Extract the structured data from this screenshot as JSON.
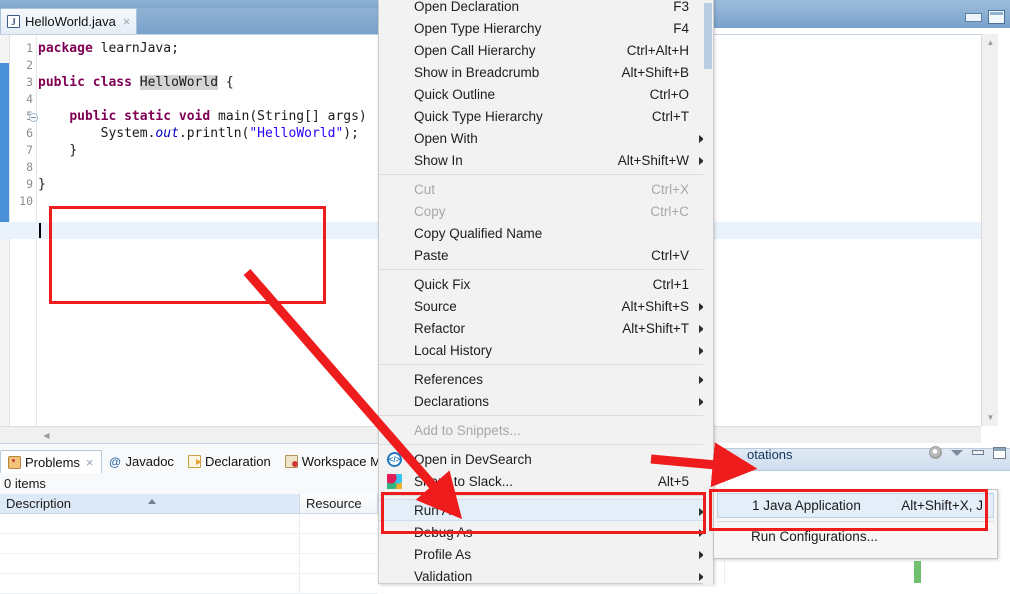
{
  "window": {
    "minimize_label": "minimize",
    "maximize_label": "maximize"
  },
  "editor": {
    "tab": {
      "label": "HelloWorld.java",
      "icon": "java-file-icon",
      "close": "×"
    },
    "line_numbers": [
      "1",
      "2",
      "3",
      "4",
      "5",
      "6",
      "7",
      "8",
      "9",
      "10"
    ],
    "code_lines": [
      {
        "n": 1,
        "text": "package learnJava;"
      },
      {
        "n": 2,
        "text": ""
      },
      {
        "n": 3,
        "text": "public class HelloWorld {"
      },
      {
        "n": 4,
        "text": ""
      },
      {
        "n": 5,
        "text": "    public static void main(String[] args)"
      },
      {
        "n": 6,
        "text": "        System.out.println(\"HelloWorld\");"
      },
      {
        "n": 7,
        "text": "    }"
      },
      {
        "n": 8,
        "text": ""
      },
      {
        "n": 9,
        "text": "}"
      },
      {
        "n": 10,
        "text": ""
      }
    ],
    "tokens": {
      "package": "package",
      "ns_learnjava": " learnJava;",
      "public": "public",
      "class": "class",
      "helloworld_type": "HelloWorld",
      "brace_open": " {",
      "static": "static",
      "void": "void",
      "main_sig": " main(String[] args)",
      "system": "System.",
      "out": "out",
      "println_open": ".println(",
      "hello_string": "\"HelloWorld\"",
      "println_close": ");",
      "brace_close_inner": "}",
      "brace_close_outer": "}"
    }
  },
  "context_menu": {
    "items": [
      {
        "label": "Open Declaration",
        "accel": "F3",
        "state": "normal",
        "submenu": false,
        "clipped": true
      },
      {
        "label": "Open Type Hierarchy",
        "accel": "F4",
        "state": "normal",
        "submenu": false
      },
      {
        "label": "Open Call Hierarchy",
        "accel": "Ctrl+Alt+H",
        "state": "normal",
        "submenu": false
      },
      {
        "label": "Show in Breadcrumb",
        "accel": "Alt+Shift+B",
        "state": "normal",
        "submenu": false
      },
      {
        "label": "Quick Outline",
        "accel": "Ctrl+O",
        "state": "normal",
        "submenu": false
      },
      {
        "label": "Quick Type Hierarchy",
        "accel": "Ctrl+T",
        "state": "normal",
        "submenu": false
      },
      {
        "label": "Open With",
        "accel": "",
        "state": "normal",
        "submenu": true
      },
      {
        "label": "Show In",
        "accel": "Alt+Shift+W",
        "state": "normal",
        "submenu": true
      },
      {
        "separator": true
      },
      {
        "label": "Cut",
        "accel": "Ctrl+X",
        "state": "disabled",
        "submenu": false
      },
      {
        "label": "Copy",
        "accel": "Ctrl+C",
        "state": "disabled",
        "submenu": false
      },
      {
        "label": "Copy Qualified Name",
        "accel": "",
        "state": "normal",
        "submenu": false
      },
      {
        "label": "Paste",
        "accel": "Ctrl+V",
        "state": "normal",
        "submenu": false
      },
      {
        "separator": true
      },
      {
        "label": "Quick Fix",
        "accel": "Ctrl+1",
        "state": "normal",
        "submenu": false
      },
      {
        "label": "Source",
        "accel": "Alt+Shift+S",
        "state": "normal",
        "submenu": true
      },
      {
        "label": "Refactor",
        "accel": "Alt+Shift+T",
        "state": "normal",
        "submenu": true
      },
      {
        "label": "Local History",
        "accel": "",
        "state": "normal",
        "submenu": true
      },
      {
        "separator": true
      },
      {
        "label": "References",
        "accel": "",
        "state": "normal",
        "submenu": true
      },
      {
        "label": "Declarations",
        "accel": "",
        "state": "normal",
        "submenu": true
      },
      {
        "separator": true
      },
      {
        "label": "Add to Snippets...",
        "accel": "",
        "state": "disabled",
        "submenu": false
      },
      {
        "separator": true
      },
      {
        "label": "Open in DevSearch",
        "accel": "",
        "state": "normal",
        "submenu": false,
        "icon": "devsearch-icon"
      },
      {
        "label": "Share to Slack...",
        "accel": "Alt+5",
        "state": "normal",
        "submenu": false,
        "icon": "slack-icon"
      },
      {
        "separator": true
      },
      {
        "label": "Run As",
        "accel": "",
        "state": "hover",
        "submenu": true
      },
      {
        "label": "Debug As",
        "accel": "",
        "state": "normal",
        "submenu": true
      },
      {
        "label": "Profile As",
        "accel": "",
        "state": "normal",
        "submenu": true
      },
      {
        "label": "Validation",
        "accel": "",
        "state": "normal",
        "submenu": true
      }
    ]
  },
  "run_as_submenu": {
    "items": [
      {
        "label": "1 Java Application",
        "accel": "Alt+Shift+X, J",
        "selected": true,
        "icon": "java-app-icon"
      },
      {
        "label": "Run Configurations...",
        "accel": "",
        "selected": false
      }
    ]
  },
  "bottom_panel": {
    "tabs": [
      {
        "label": "Problems",
        "icon": "problems-icon",
        "active": true,
        "closable": true
      },
      {
        "label": "Javadoc",
        "icon": "javadoc-icon",
        "active": false
      },
      {
        "label": "Declaration",
        "icon": "declaration-icon",
        "active": false
      },
      {
        "label": "Workspace Migrat",
        "icon": "workspace-migration-icon",
        "active": false
      }
    ],
    "items_count": "0 items",
    "columns": [
      "Description",
      "Resource"
    ],
    "rows": []
  },
  "annotations_view": {
    "tab_label": "otations",
    "tools": [
      "gear-icon",
      "chevron-down-icon",
      "minimize-icon",
      "maximize-icon"
    ]
  },
  "annotations_overlay": {
    "color": "#ee1c1c",
    "shapes": [
      {
        "type": "rect",
        "name": "editor-callout-box"
      },
      {
        "type": "arrow",
        "name": "arrow-to-run-as"
      },
      {
        "type": "rect",
        "name": "run-as-highlight-box"
      },
      {
        "type": "arrow",
        "name": "arrow-to-annotations-tab"
      },
      {
        "type": "rect",
        "name": "java-application-highlight-box"
      }
    ]
  }
}
